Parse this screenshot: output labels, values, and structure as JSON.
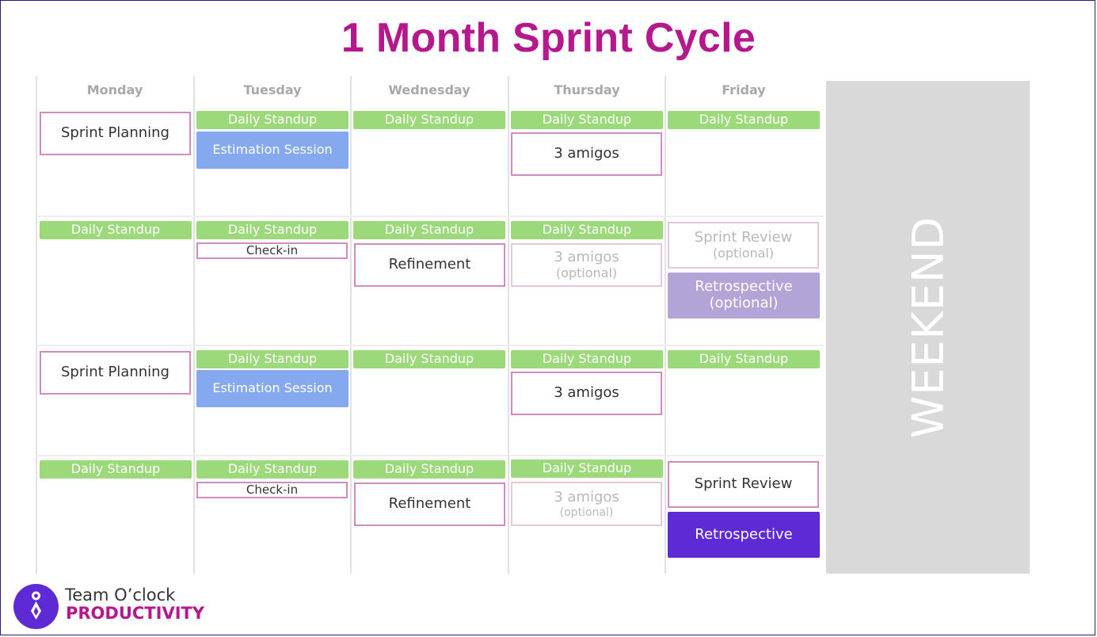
{
  "title": "1 Month Sprint Cycle",
  "days": [
    "Monday",
    "Tuesday",
    "Wednesday",
    "Thursday",
    "Friday"
  ],
  "weekend_label": "WEEKEND",
  "colors": {
    "title": "#b5178c",
    "standup": "#9cd97a",
    "estimation": "#85a9ee",
    "outline_border": "#d08cc0",
    "retro_optional": "#b2a4d6",
    "retro": "#5d2ad6",
    "weekend": "#d9d9d9",
    "brand_accent": "#b5178c"
  },
  "weeks": [
    {
      "monday": [
        {
          "label": "Sprint Planning"
        }
      ],
      "tuesday": [
        {
          "label": "Daily Standup"
        },
        {
          "label": "Estimation Session"
        }
      ],
      "wednesday": [
        {
          "label": "Daily Standup"
        }
      ],
      "thursday": [
        {
          "label": "Daily Standup"
        },
        {
          "label": "3 amigos"
        }
      ],
      "friday": [
        {
          "label": "Daily Standup"
        }
      ]
    },
    {
      "monday": [
        {
          "label": "Daily Standup"
        }
      ],
      "tuesday": [
        {
          "label": "Daily Standup"
        },
        {
          "label": "Check-in"
        }
      ],
      "wednesday": [
        {
          "label": "Daily Standup"
        },
        {
          "label": "Refinement"
        }
      ],
      "thursday": [
        {
          "label": "Daily Standup"
        },
        {
          "label": "3 amigos",
          "note": "(optional)"
        }
      ],
      "friday": [
        {
          "label": "Sprint Review",
          "note": "(optional)"
        },
        {
          "label": "Retrospective",
          "note": "(optional)"
        }
      ]
    },
    {
      "monday": [
        {
          "label": "Sprint Planning"
        }
      ],
      "tuesday": [
        {
          "label": "Daily Standup"
        },
        {
          "label": "Estimation Session"
        }
      ],
      "wednesday": [
        {
          "label": "Daily Standup"
        }
      ],
      "thursday": [
        {
          "label": "Daily Standup"
        },
        {
          "label": "3 amigos"
        }
      ],
      "friday": [
        {
          "label": "Daily Standup"
        }
      ]
    },
    {
      "monday": [
        {
          "label": "Daily Standup"
        }
      ],
      "tuesday": [
        {
          "label": "Daily Standup"
        },
        {
          "label": "Check-in"
        }
      ],
      "wednesday": [
        {
          "label": "Daily Standup"
        },
        {
          "label": "Refinement"
        }
      ],
      "thursday": [
        {
          "label": "Daily Standup"
        },
        {
          "label": "3 amigos",
          "note": "(optional)"
        }
      ],
      "friday": [
        {
          "label": "Sprint Review"
        },
        {
          "label": "Retrospective"
        }
      ]
    }
  ],
  "brand": {
    "logo_icon": "tie-icon",
    "name": "Team O’clock",
    "tagline": "PRODUCTIVITY"
  }
}
